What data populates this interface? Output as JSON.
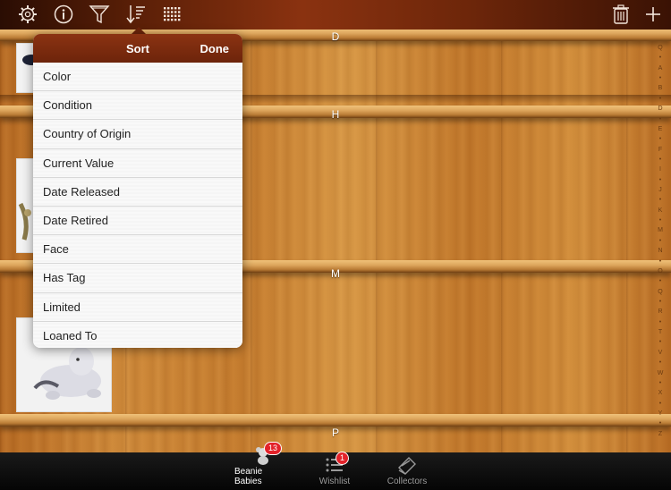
{
  "toolbar": {
    "icons": [
      "gear-icon",
      "info-icon",
      "filter-icon",
      "sort-icon",
      "grid-icon",
      "trash-icon",
      "plus-icon"
    ]
  },
  "shelves": {
    "letters": [
      "D",
      "H",
      "M",
      "P"
    ]
  },
  "index_letters": [
    "Q",
    "A",
    "B",
    "D",
    "E",
    "F",
    "I",
    "J",
    "K",
    "M",
    "N",
    "O",
    "Q",
    "R",
    "T",
    "V",
    "W",
    "X",
    "Y",
    "Z"
  ],
  "sort_popover": {
    "title": "Sort",
    "done_label": "Done",
    "items": [
      "Color",
      "Condition",
      "Country of Origin",
      "Current Value",
      "Date Released",
      "Date Retired",
      "Face",
      "Has Tag",
      "Limited",
      "Loaned To"
    ]
  },
  "tabbar": {
    "tabs": [
      {
        "label": "Beanie Babies",
        "badge": "13",
        "icon": "bear-icon",
        "active": true
      },
      {
        "label": "Wishlist",
        "badge": "1",
        "icon": "list-icon",
        "active": false
      },
      {
        "label": "Collectors",
        "badge": "",
        "icon": "collectors-icon",
        "active": false
      }
    ]
  },
  "colors": {
    "toolbar_accent": "#8a3210",
    "badge": "#e3222a",
    "wood": "#c57c2e"
  }
}
